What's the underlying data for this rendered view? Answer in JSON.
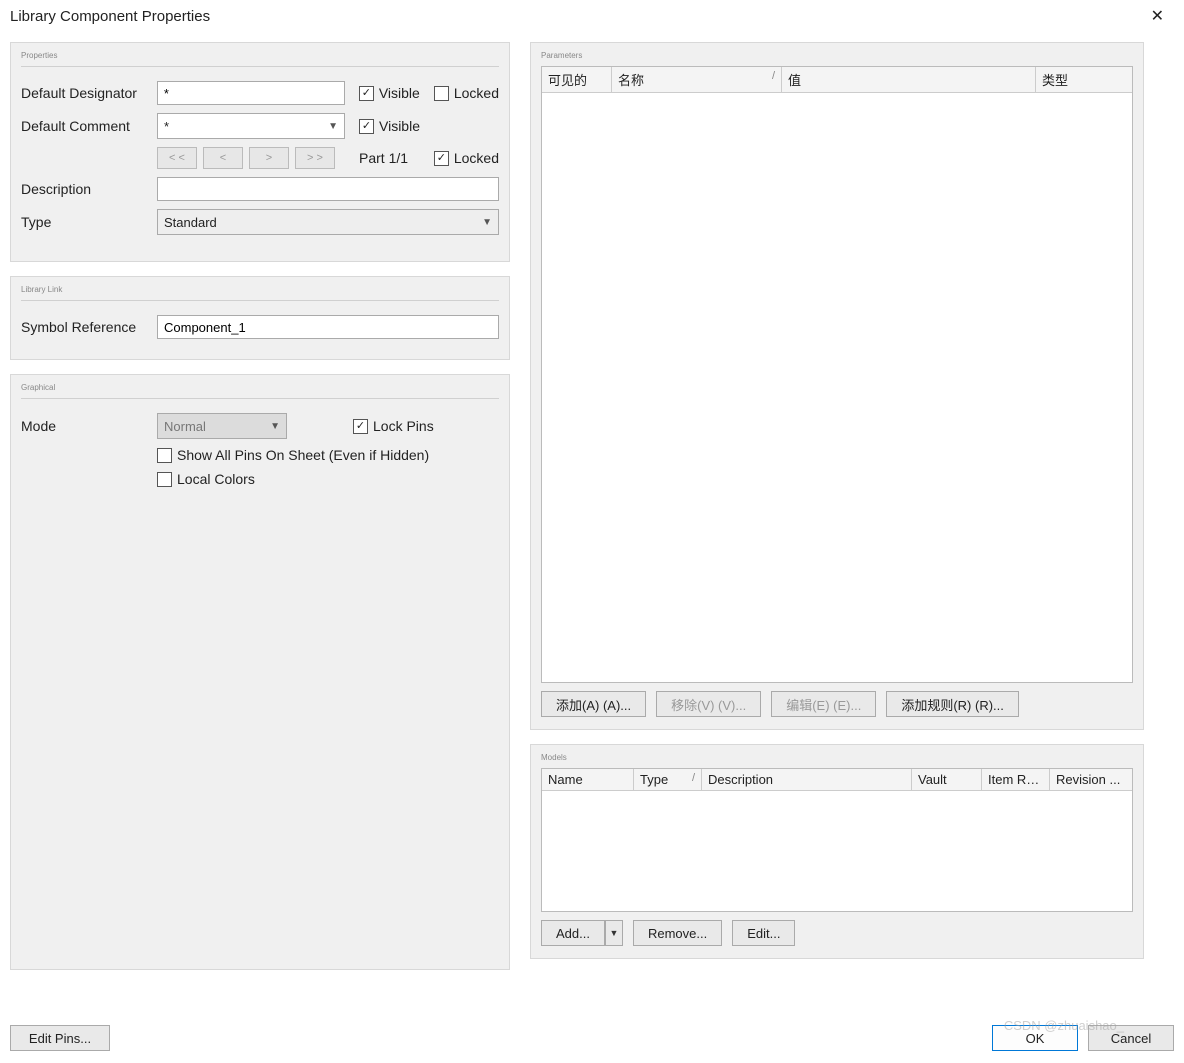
{
  "title": "Library Component Properties",
  "properties": {
    "group_title": "Properties",
    "default_designator": {
      "label": "Default Designator",
      "value": "*",
      "visible": "Visible",
      "locked": "Locked",
      "visible_checked": true,
      "locked_checked": false
    },
    "default_comment": {
      "label": "Default Comment",
      "value": "*",
      "visible": "Visible",
      "visible_checked": true
    },
    "nav": {
      "first": "< <",
      "prev": "<",
      "next": ">",
      "last": "> >",
      "part": "Part 1/1",
      "locked": "Locked",
      "locked_checked": true
    },
    "description": {
      "label": "Description",
      "value": ""
    },
    "type": {
      "label": "Type",
      "value": "Standard"
    }
  },
  "library_link": {
    "group_title": "Library Link",
    "symbol_reference": {
      "label": "Symbol Reference",
      "value": "Component_1"
    }
  },
  "graphical": {
    "group_title": "Graphical",
    "mode": {
      "label": "Mode",
      "value": "Normal"
    },
    "lock_pins": {
      "label": "Lock Pins",
      "checked": true
    },
    "show_all_pins": {
      "label": "Show All Pins On Sheet (Even if Hidden)",
      "checked": false
    },
    "local_colors": {
      "label": "Local Colors",
      "checked": false
    }
  },
  "parameters": {
    "group_title": "Parameters",
    "columns": {
      "visible": "可见的",
      "name": "名称",
      "value": "值",
      "type": "类型"
    },
    "buttons": {
      "add": "添加(A) (A)...",
      "remove": "移除(V) (V)...",
      "edit": "编辑(E) (E)...",
      "add_rule": "添加规则(R) (R)..."
    }
  },
  "models": {
    "group_title": "Models",
    "columns": {
      "name": "Name",
      "type": "Type",
      "description": "Description",
      "vault": "Vault",
      "item_rev": "Item Rev...",
      "revision": "Revision ..."
    },
    "buttons": {
      "add": "Add...",
      "remove": "Remove...",
      "edit": "Edit..."
    }
  },
  "footer": {
    "edit_pins": "Edit Pins...",
    "ok": "OK",
    "cancel": "Cancel"
  },
  "watermark": "CSDN @zhuaishao_"
}
